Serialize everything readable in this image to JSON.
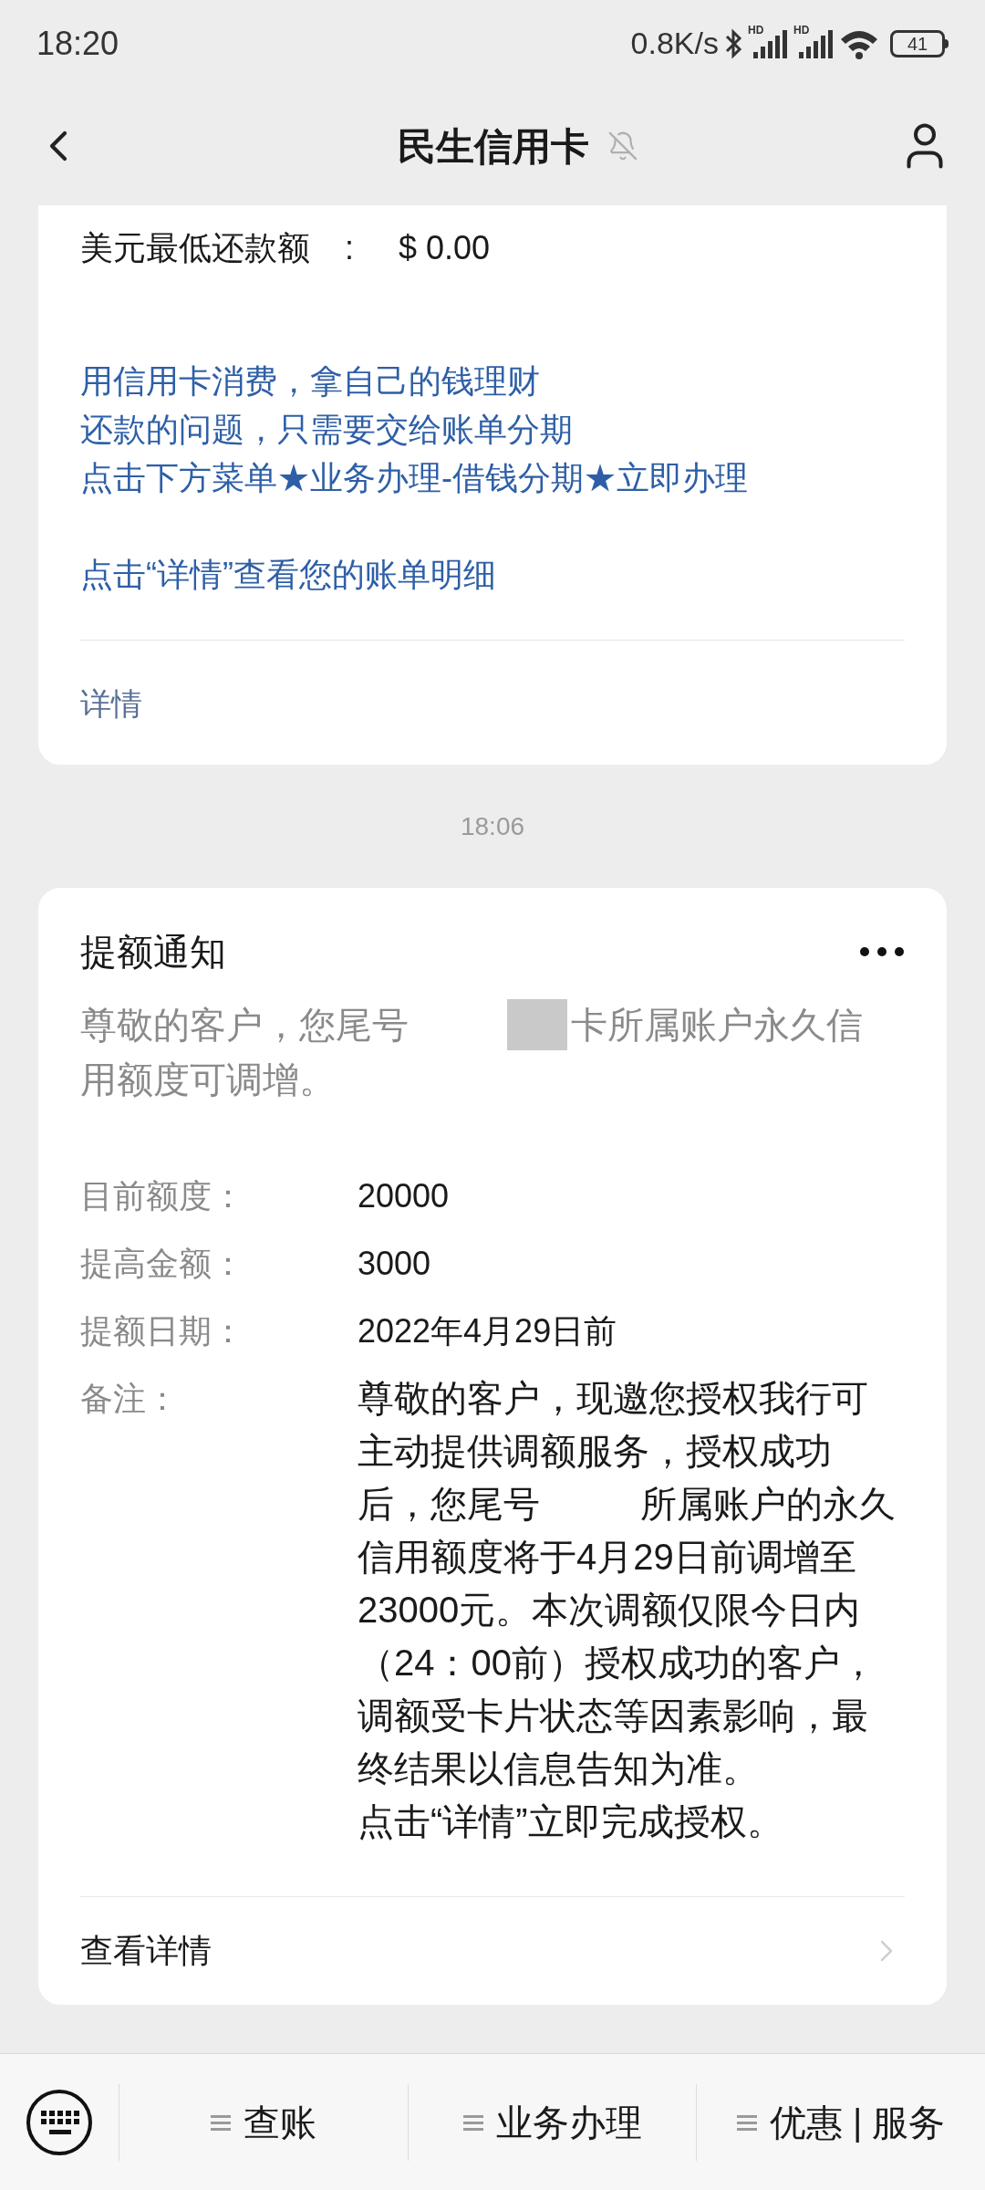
{
  "status_bar": {
    "time": "18:20",
    "network_speed": "0.8K/s",
    "battery": "41",
    "signal_labels": [
      "HD",
      "HD"
    ]
  },
  "header": {
    "title": "民生信用卡",
    "muted": true
  },
  "bill_card": {
    "rows": [
      {
        "label": "美元最低还款额",
        "separator": ":",
        "value": "$ 0.00"
      }
    ],
    "promo_lines": [
      "用信用卡消费，拿自己的钱理财",
      "还款的问题，只需要交给账单分期",
      "点击下方菜单★业务办理-借钱分期★立即办理"
    ],
    "hint": "点击“详情”查看您的账单明细",
    "link": "详情"
  },
  "timestamp": "18:06",
  "notice_card": {
    "title": "提额通知",
    "intro_parts": [
      "尊敬的客户，您尾号",
      "卡所属账户永久信",
      "用额度可调增。"
    ],
    "fields": [
      {
        "label": "目前额度：",
        "value": "20000"
      },
      {
        "label": "提高金额：",
        "value": "3000"
      },
      {
        "label": "提额日期：",
        "value": "2022年4月29日前"
      }
    ],
    "note": {
      "label": "备注：",
      "lines": [
        [
          "尊敬的客户，现邀您授权我行可"
        ],
        [
          "主动提供调额服务，授权成功"
        ],
        [
          "后，您尾号",
          "所属账户的永久"
        ],
        [
          "信用额度将于4月29日前调增至"
        ],
        [
          "23000元。本次调额仅限今日内"
        ],
        [
          "（24：00前）授权成功的客户，"
        ],
        [
          "调额受卡片状态等因素影响，最"
        ],
        [
          "终结果以信息告知为准。"
        ],
        [
          "点击“详情”立即完成授权。"
        ]
      ]
    },
    "footer_link": "查看详情"
  },
  "bottom_menu": {
    "items": [
      {
        "label": "查账"
      },
      {
        "label": "业务办理"
      },
      {
        "label": "优惠 | 服务"
      }
    ]
  }
}
